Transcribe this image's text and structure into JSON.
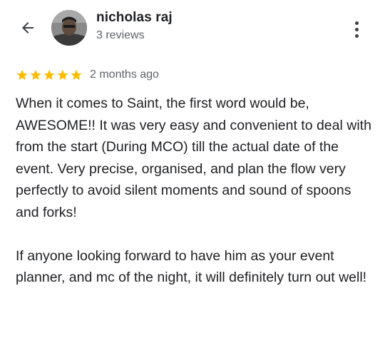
{
  "header": {
    "reviewer_name": "nicholas raj",
    "review_count": "3 reviews",
    "back_icon": "arrow-back-icon",
    "more_icon": "more-vert-icon"
  },
  "review": {
    "rating": 5,
    "rating_max": 5,
    "star_color": "#fbbc04",
    "date": "2 months ago",
    "paragraphs": [
      "When it comes to Saint, the first word would be, AWESOME!! It was very easy and convenient to deal with from the start (During MCO) till the actual date of the event. Very precise, organised, and plan the flow very perfectly to avoid silent moments and sound of spoons and forks!",
      "If anyone looking forward to have him as your event planner, and mc of the night, it will definitely turn out well!"
    ]
  }
}
